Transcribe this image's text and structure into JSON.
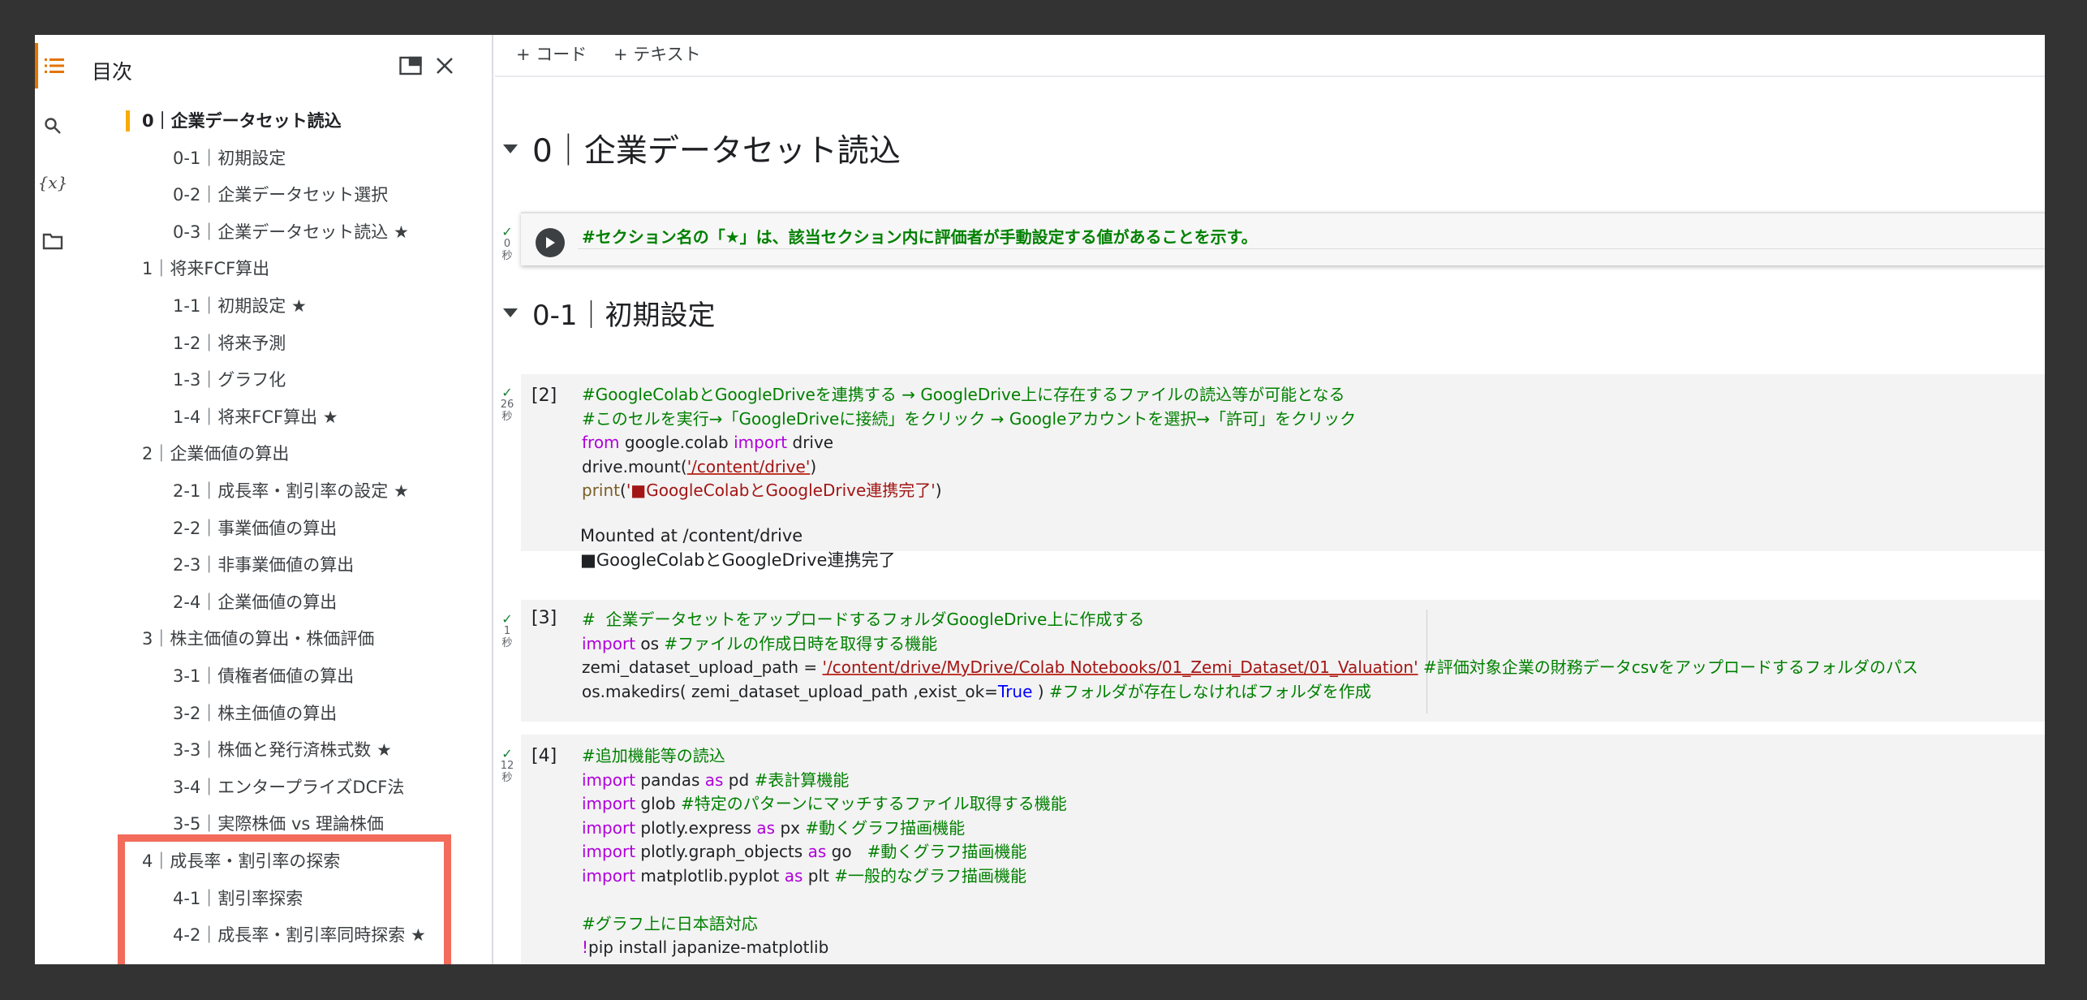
{
  "toc": {
    "title": "目次",
    "items": [
      {
        "label": "0｜企業データセット読込",
        "level": 0,
        "active": true
      },
      {
        "label": "0-1｜初期設定",
        "level": 1
      },
      {
        "label": "0-2｜企業データセット選択",
        "level": 1
      },
      {
        "label": "0-3｜企業データセット読込 ★",
        "level": 1
      },
      {
        "label": "1｜将来FCF算出",
        "level": 0
      },
      {
        "label": "1-1｜初期設定 ★",
        "level": 1
      },
      {
        "label": "1-2｜将来予測",
        "level": 1
      },
      {
        "label": "1-3｜グラフ化",
        "level": 1
      },
      {
        "label": "1-4｜将来FCF算出 ★",
        "level": 1
      },
      {
        "label": "2｜企業価値の算出",
        "level": 0
      },
      {
        "label": "2-1｜成長率・割引率の設定 ★",
        "level": 1
      },
      {
        "label": "2-2｜事業価値の算出",
        "level": 1
      },
      {
        "label": "2-3｜非事業価値の算出",
        "level": 1
      },
      {
        "label": "2-4｜企業価値の算出",
        "level": 1
      },
      {
        "label": "3｜株主価値の算出・株価評価",
        "level": 0
      },
      {
        "label": "3-1｜債権者価値の算出",
        "level": 1
      },
      {
        "label": "3-2｜株主価値の算出",
        "level": 1
      },
      {
        "label": "3-3｜株価と発行済株式数 ★",
        "level": 1
      },
      {
        "label": "3-4｜エンタープライズDCF法",
        "level": 1
      },
      {
        "label": "3-5｜実際株価 vs 理論株価",
        "level": 1
      },
      {
        "label": "4｜成長率・割引率の探索",
        "level": 0
      },
      {
        "label": "4-1｜割引率探索",
        "level": 1
      },
      {
        "label": "4-2｜成長率・割引率同時探索 ★",
        "level": 1
      }
    ]
  },
  "toolbar": {
    "add_code": "+ コード",
    "add_text": "+ テキスト"
  },
  "notebook": {
    "heading_0": "0｜企業データセット読込",
    "heading_01": "0-1｜初期設定",
    "cell_note": {
      "status": "0",
      "unit": "秒",
      "text": "#セクション名の「★」は、該当セクション内に評価者が手動設定する値があることを示す。"
    },
    "cell_2": {
      "count": "[2]",
      "status": "26",
      "unit": "秒",
      "line1": "#GoogleColabとGoogleDriveを連携する → GoogleDrive上に存在するファイルの読込等が可能となる",
      "line2": "#このセルを実行→「GoogleDriveに接続」をクリック → Googleアカウントを選択→「許可」をクリック",
      "line3_kw1": "from",
      "line3_mid": " google.colab ",
      "line3_kw2": "import",
      "line3_end": " drive",
      "line4_pre": "drive.mount(",
      "line4_str": "'/content/drive'",
      "line4_post": ")",
      "line5_fn": "print",
      "line5_pre": "(",
      "line5_str": "'■GoogleColabとGoogleDrive連携完了'",
      "line5_post": ")",
      "output1": "Mounted at /content/drive",
      "output2": "■GoogleColabとGoogleDrive連携完了"
    },
    "cell_3": {
      "count": "[3]",
      "status": "1",
      "unit": "秒",
      "line1": "#  企業データセットをアップロードするフォルダGoogleDrive上に作成する",
      "line2_kw": "import",
      "line2_mid": " os ",
      "line2_com": "#ファイルの作成日時を取得する機能",
      "line3_pre": "zemi_dataset_upload_path = ",
      "line3_str": "'/content/drive/MyDrive/Colab Notebooks/01_Zemi_Dataset/01_Valuation'",
      "line3_com": " #評価対象企業の財務データcsvをアップロードするフォルダのパス",
      "line4_pre": "os.makedirs( zemi_dataset_upload_path ,exist_ok=",
      "line4_const": "True",
      "line4_post": " ) ",
      "line4_com": "#フォルダが存在しなければフォルダを作成"
    },
    "cell_4": {
      "count": "[4]",
      "status": "12",
      "unit": "秒",
      "line1": "#追加機能等の読込",
      "line2_kw": "import",
      "line2_mid": " pandas ",
      "line2_kw2": "as",
      "line2_alias": " pd ",
      "line2_com": "#表計算機能",
      "line3_kw": "import",
      "line3_mid": " glob ",
      "line3_com": "#特定のパターンにマッチするファイル取得する機能",
      "line4_kw": "import",
      "line4_mid": " plotly.express ",
      "line4_kw2": "as",
      "line4_alias": " px ",
      "line4_com": "#動くグラフ描画機能",
      "line5_kw": "import",
      "line5_mid": " plotly.graph_objects ",
      "line5_kw2": "as",
      "line5_alias": " go   ",
      "line5_com": "#動くグラフ描画機能",
      "line6_kw": "import",
      "line6_mid": " matplotlib.pyplot ",
      "line6_kw2": "as",
      "line6_alias": " plt ",
      "line6_com": "#一般的なグラフ描画機能",
      "line8": "#グラフ上に日本語対応",
      "line9_kw": "!",
      "line9_rest": "pip install japanize-matplotlib"
    }
  },
  "colors": {
    "accent": "#e37400",
    "marker": "#f9ab00",
    "highlight_border": "#f26b5b",
    "comment": "#008000",
    "keyword": "#af00db",
    "string": "#a31515"
  },
  "icons": [
    "toc-icon",
    "search-icon",
    "variables-icon",
    "folder-icon",
    "open-in-window-icon",
    "close-icon",
    "run-icon",
    "check-icon",
    "collapse-caret-icon"
  ]
}
